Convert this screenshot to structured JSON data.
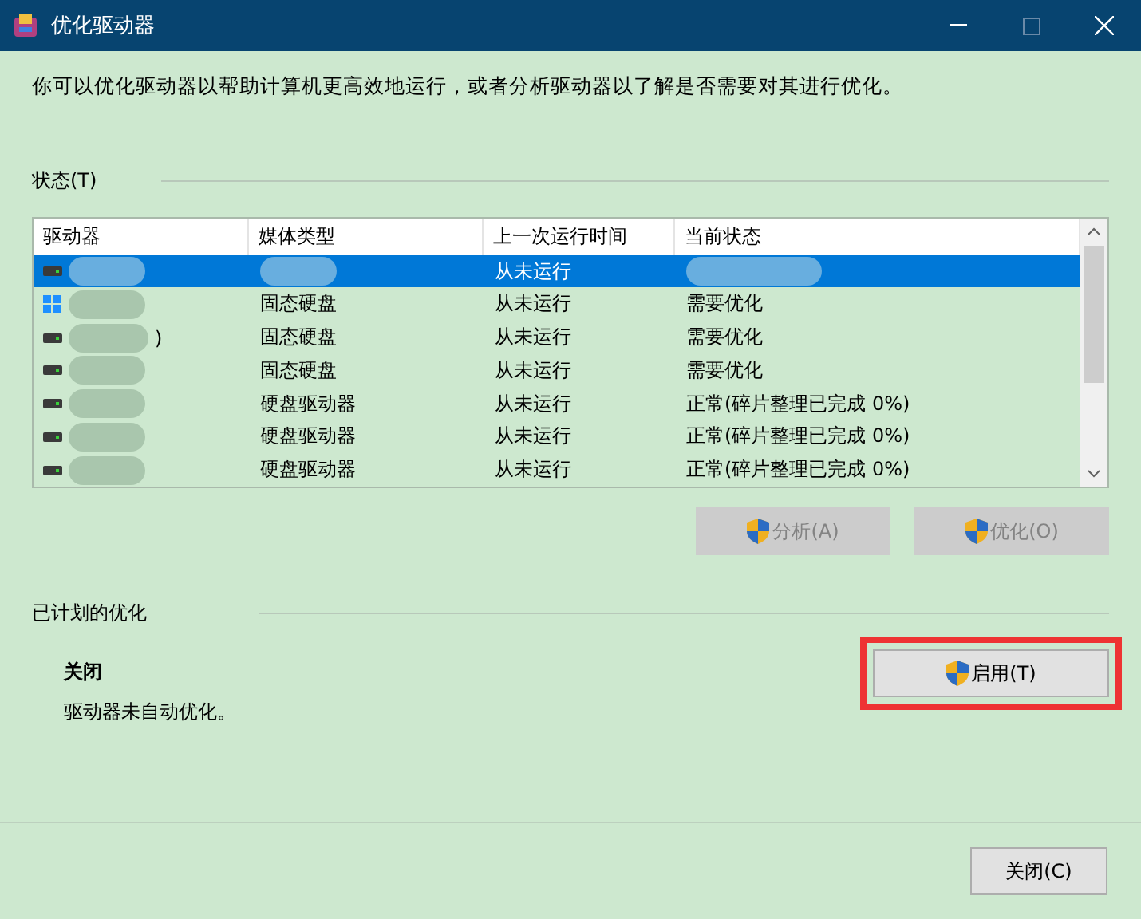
{
  "window": {
    "title": "优化驱动器",
    "controls": [
      {
        "kind": "minimize",
        "disabled": false
      },
      {
        "kind": "maximize",
        "disabled": true
      },
      {
        "kind": "close",
        "disabled": false
      }
    ]
  },
  "intro": "你可以优化驱动器以帮助计算机更高效地运行，或者分析驱动器以了解是否需要对其进行优化。",
  "status_section": {
    "label": "状态(T)",
    "table": {
      "columns": [
        "驱动器",
        "媒体类型",
        "上一次运行时间",
        "当前状态"
      ],
      "rows": [
        {
          "selected": true,
          "kind": "drive",
          "last_run": "从未运行"
        },
        {
          "selected": false,
          "kind": "system",
          "media": "固态硬盘",
          "last_run": "从未运行",
          "status": "需要优化"
        },
        {
          "selected": false,
          "kind": "drive",
          "drive_fragment": ")",
          "media": "固态硬盘",
          "last_run": "从未运行",
          "status": "需要优化"
        },
        {
          "selected": false,
          "kind": "drive",
          "media": "固态硬盘",
          "last_run": "从未运行",
          "status": "需要优化"
        },
        {
          "selected": false,
          "kind": "drive",
          "media": "硬盘驱动器",
          "last_run": "从未运行",
          "status": "正常(碎片整理已完成 0%)"
        },
        {
          "selected": false,
          "kind": "drive",
          "media": "硬盘驱动器",
          "last_run": "从未运行",
          "status": "正常(碎片整理已完成 0%)"
        },
        {
          "selected": false,
          "kind": "drive",
          "media": "硬盘驱动器",
          "last_run": "从未运行",
          "status": "正常(碎片整理已完成 0%)"
        }
      ]
    },
    "buttons": [
      {
        "label": "分析(A)",
        "disabled": true
      },
      {
        "label": "优化(O)",
        "disabled": true
      }
    ]
  },
  "schedule_section": {
    "label": "已计划的优化",
    "state": "关闭",
    "description": "驱动器未自动优化。",
    "button": {
      "label": "启用(T)",
      "disabled": false,
      "highlighted": true
    }
  },
  "footer": {
    "button": "关闭(C)"
  }
}
